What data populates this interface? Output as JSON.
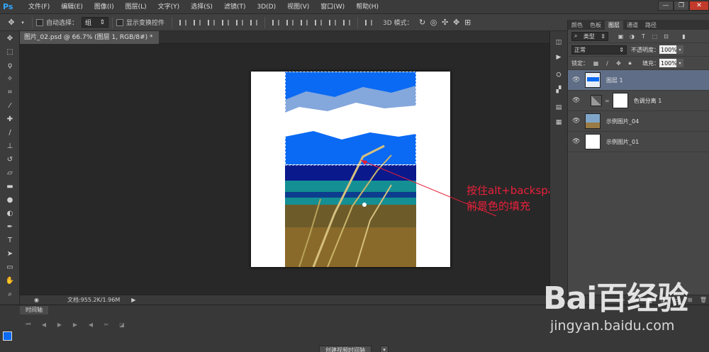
{
  "app": {
    "logo": "Ps",
    "menus": [
      "文件(F)",
      "编辑(E)",
      "图像(I)",
      "图层(L)",
      "文字(Y)",
      "选择(S)",
      "滤镜(T)",
      "3D(D)",
      "视图(V)",
      "窗口(W)",
      "帮助(H)"
    ],
    "window_controls": [
      "—",
      "❐",
      "✕"
    ]
  },
  "options": {
    "auto_select_label": "自动选择：",
    "auto_select_value": "组",
    "transform_label": "显示变换控件",
    "mode_label": "3D 模式："
  },
  "document": {
    "tab_title": "图片_02.psd @ 66.7% (图层 1, RGB/8#) *",
    "doc_size": "文档:955.2K/1.96M",
    "annotation_line1": "按住alt+backspace组合键进行",
    "annotation_line2": "前景色的填充"
  },
  "timeline": {
    "tab_label": "时间轴",
    "create_button": "创建视频时间轴"
  },
  "panel": {
    "tabs": [
      "颜色",
      "色板",
      "图层",
      "通道",
      "路径"
    ],
    "active_tab": 2,
    "filter_kind": "类型",
    "blend_mode": "正常",
    "opacity_label": "不透明度：",
    "opacity_value": "100%",
    "lock_label": "锁定：",
    "fill_label": "填充：",
    "fill_value": "100%",
    "layers": [
      {
        "name": "图层 1",
        "selected": true
      },
      {
        "name": "色调分离 1",
        "selected": false
      },
      {
        "name": "示例图片_04",
        "selected": false
      },
      {
        "name": "示例图片_01",
        "selected": false
      }
    ]
  },
  "colors": {
    "foreground": "#0b6af3",
    "background": "#ffffff",
    "annotation": "#e9203a",
    "selected_layer": "#5f6e86"
  },
  "watermark": {
    "logo": "Bai百经验",
    "url": "jingyan.baidu.com"
  }
}
